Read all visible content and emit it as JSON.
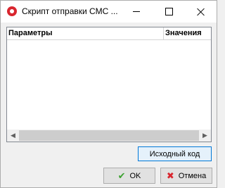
{
  "window": {
    "title": "Скрипт отправки СМС ..."
  },
  "grid": {
    "columns": [
      "Параметры",
      "Значения"
    ],
    "rows": []
  },
  "scrollbar": {
    "left_arrow": "◀",
    "right_arrow": "▶"
  },
  "buttons": {
    "source_code": "Исходный код",
    "ok": "OK",
    "cancel": "Отмена"
  },
  "icons": {
    "ok": "✔",
    "cancel": "✖"
  },
  "colors": {
    "app_icon": "#d9262f",
    "ok_icon": "#3aa12f",
    "cancel_icon": "#d9262f",
    "focus_border": "#0078d7"
  }
}
